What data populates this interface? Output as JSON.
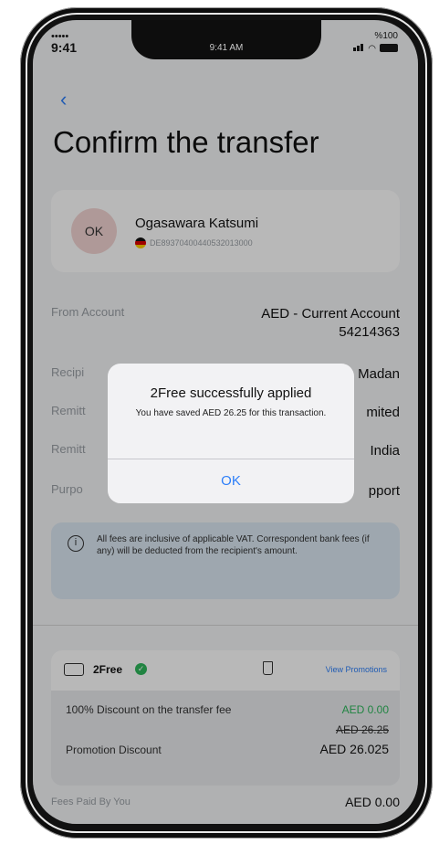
{
  "status_bar": {
    "carrier": "•••••",
    "time": "9:41",
    "center_time": "9:41 AM",
    "battery_pct": "%100"
  },
  "page": {
    "back_icon": "chevron-left-icon",
    "title": "Confirm the transfer"
  },
  "recipient": {
    "initials": "OK",
    "name": "Ogasawara Katsumi",
    "iban": "DE89370400440532013000"
  },
  "details": {
    "from_label": "From Account",
    "from_value_1": "AED - Current Account",
    "from_value_2": "54214363",
    "r2_label": "Recipi",
    "r2_value": "Madan",
    "r3_label": "Remitt",
    "r3_value": "mited",
    "r4_label": "Remitt",
    "r4_value": "India",
    "r5_label": "Purpo",
    "r5_value": "pport"
  },
  "info_note": "All fees are inclusive of applicable VAT. Correspondent bank fees (if any) will be deducted from the recipient's amount.",
  "promo": {
    "name": "2Free",
    "view_label": "View Promotions",
    "discount_label": "100% Discount on the transfer fee",
    "discount_value": "AED 0.00",
    "original_fee": "AED 26.25",
    "promo_label": "Promotion Discount",
    "promo_value": "AED 26.025"
  },
  "fees": {
    "label": "Fees Paid By You",
    "value": "AED 0.00"
  },
  "modal": {
    "title": "2Free successfully applied",
    "body": "You have saved AED 26.25 for this transaction.",
    "ok_label": "OK"
  },
  "colors": {
    "accent": "#2d7ff9",
    "success": "#2eb85c",
    "info_bg": "#dbe8f3",
    "avatar_bg": "#f3d5d3"
  }
}
